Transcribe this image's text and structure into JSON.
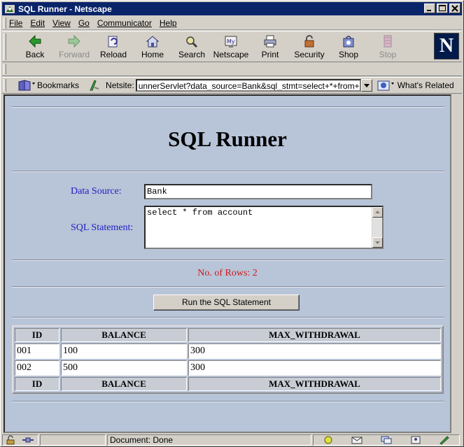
{
  "window": {
    "title": "SQL Runner - Netscape"
  },
  "menu": [
    "File",
    "Edit",
    "View",
    "Go",
    "Communicator",
    "Help"
  ],
  "toolbar": {
    "buttons": [
      {
        "label": "Back",
        "icon": "back-arrow-icon",
        "enabled": true
      },
      {
        "label": "Forward",
        "icon": "forward-arrow-icon",
        "enabled": false
      },
      {
        "label": "Reload",
        "icon": "reload-icon",
        "enabled": true
      },
      {
        "label": "Home",
        "icon": "home-icon",
        "enabled": true
      },
      {
        "label": "Search",
        "icon": "search-icon",
        "enabled": true
      },
      {
        "label": "Netscape",
        "icon": "my-netscape-icon",
        "enabled": true
      },
      {
        "label": "Print",
        "icon": "printer-icon",
        "enabled": true
      },
      {
        "label": "Security",
        "icon": "padlock-icon",
        "enabled": true
      },
      {
        "label": "Shop",
        "icon": "shop-bag-icon",
        "enabled": true
      },
      {
        "label": "Stop",
        "icon": "stop-icon",
        "enabled": false
      }
    ],
    "logo_letter": "N"
  },
  "location": {
    "bookmarks_label": "Bookmarks",
    "netsite_label": "Netsite:",
    "url": "unnerServlet?data_source=Bank&sql_stmt=select+*+from+account",
    "whats_related": "What's Related"
  },
  "page": {
    "title": "SQL Runner",
    "data_source_label": "Data Source:",
    "data_source_value": "Bank",
    "sql_label": "SQL Statement:",
    "sql_value": "select * from account",
    "rows_text": "No. of Rows: 2",
    "run_button": "Run the SQL Statement",
    "table": {
      "headers": [
        "ID",
        "BALANCE",
        "MAX_WITHDRAWAL"
      ],
      "rows": [
        [
          "001",
          "100",
          "300"
        ],
        [
          "002",
          "500",
          "300"
        ]
      ]
    }
  },
  "status": {
    "text": "Document: Done"
  },
  "colors": {
    "titlebar": "#0a246a",
    "page_background": "#b8c4d8",
    "label_blue": "#2020c0",
    "rows_red": "#d01818"
  }
}
